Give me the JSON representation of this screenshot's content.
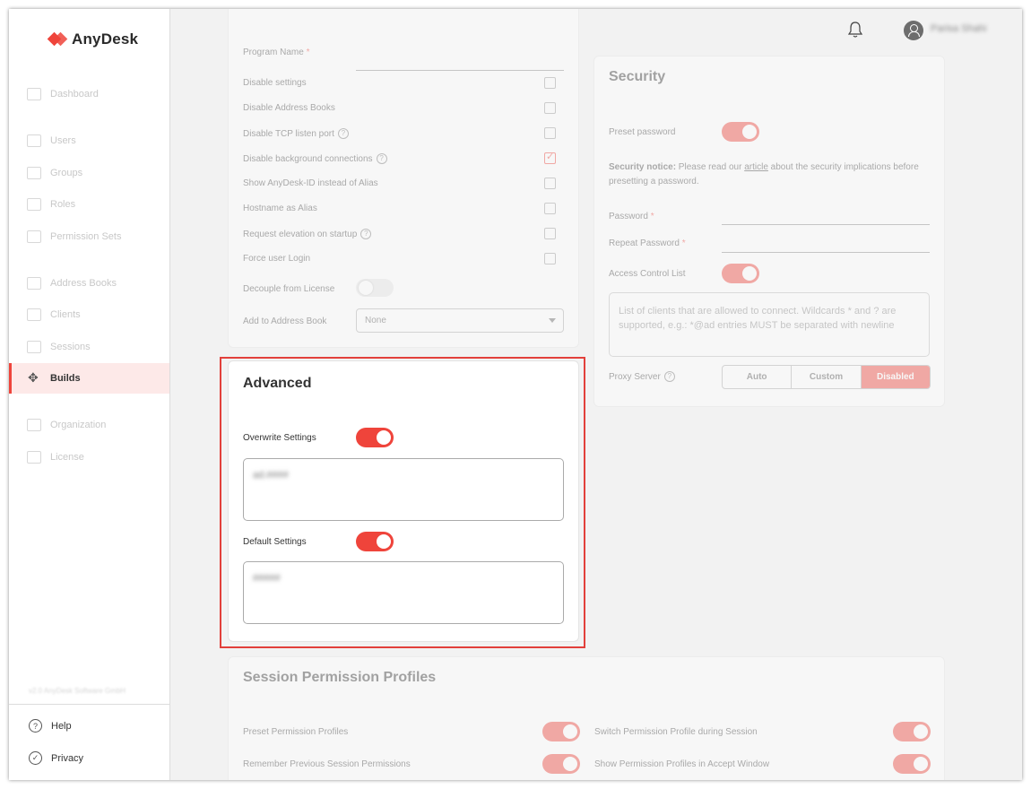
{
  "brand": {
    "name": "AnyDesk",
    "color": "#ef443b"
  },
  "sidebar": {
    "items": [
      {
        "label": "Dashboard",
        "icon": "grid-icon"
      },
      {
        "label": "Users",
        "icon": "user-icon"
      },
      {
        "label": "Groups",
        "icon": "group-icon"
      },
      {
        "label": "Roles",
        "icon": "role-icon"
      },
      {
        "label": "Permission Sets",
        "icon": "permission-icon"
      },
      {
        "label": "Address Books",
        "icon": "book-icon"
      },
      {
        "label": "Clients",
        "icon": "monitor-icon"
      },
      {
        "label": "Sessions",
        "icon": "arrows-icon"
      },
      {
        "label": "Builds",
        "icon": "move-icon",
        "active": true
      },
      {
        "label": "Organization",
        "icon": "building-icon"
      },
      {
        "label": "License",
        "icon": "license-icon"
      }
    ],
    "copyright": "v2.0 AnyDesk Software GmbH",
    "help": "Help",
    "privacy": "Privacy"
  },
  "topbar": {
    "username": "Parisa Shahi"
  },
  "general": {
    "program_name_label": "Program Name",
    "required_mark": "*",
    "rows": [
      {
        "label": "Disable settings",
        "help": false,
        "checked": false
      },
      {
        "label": "Disable Address Books",
        "help": false,
        "checked": false
      },
      {
        "label": "Disable TCP listen port",
        "help": true,
        "checked": false
      },
      {
        "label": "Disable background connections",
        "help": true,
        "checked": true
      },
      {
        "label": "Show AnyDesk-ID instead of Alias",
        "help": false,
        "checked": false
      },
      {
        "label": "Hostname as Alias",
        "help": false,
        "checked": false
      },
      {
        "label": "Request elevation on startup",
        "help": true,
        "checked": false
      },
      {
        "label": "Force user Login",
        "help": false,
        "checked": false
      }
    ],
    "decouple_label": "Decouple from License",
    "address_book_label": "Add to Address Book",
    "address_book_value": "None"
  },
  "advanced": {
    "title": "Advanced",
    "overwrite_label": "Overwrite Settings",
    "overwrite_value": "ad.####",
    "default_label": "Default Settings",
    "default_value": "#####"
  },
  "security": {
    "title": "Security",
    "preset_password_label": "Preset password",
    "notice_bold": "Security notice:",
    "notice_pre": " Please read our ",
    "notice_link": "article",
    "notice_post": " about the security implications before presetting a password.",
    "password_label": "Password",
    "repeat_password_label": "Repeat Password",
    "required_mark": "*",
    "acl_label": "Access Control List",
    "acl_placeholder": "List of clients that are allowed to connect. Wildcards * and ? are supported, e.g.: *@ad entries MUST be separated with newline",
    "proxy_label": "Proxy Server",
    "proxy_options": [
      "Auto",
      "Custom",
      "Disabled"
    ]
  },
  "session_profiles": {
    "title": "Session Permission Profiles",
    "preset_label": "Preset Permission Profiles",
    "switch_label": "Switch Permission Profile during Session",
    "remember_label": "Remember Previous Session Permissions",
    "show_label": "Show Permission Profiles in Accept Window"
  }
}
